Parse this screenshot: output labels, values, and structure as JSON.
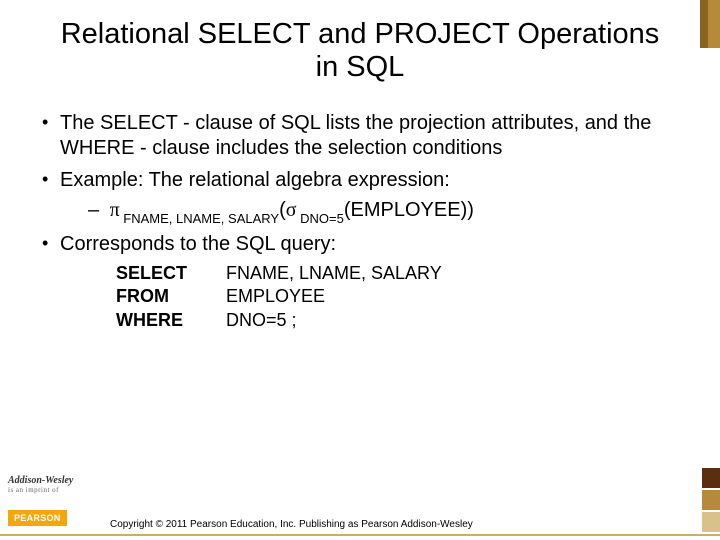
{
  "title": "Relational SELECT and PROJECT Operations in SQL",
  "bullets": {
    "b1": "The SELECT - clause of SQL lists the projection attributes, and the WHERE - clause includes the selection conditions",
    "b2": "Example: The relational algebra expression:",
    "b3": "Corresponds to the SQL query:"
  },
  "algebra": {
    "pi": "π",
    "pi_sub": " FNAME, LNAME, SALARY",
    "open": "(",
    "sigma": "σ",
    "sigma_sub": " DNO=5",
    "rest": "(EMPLOYEE))"
  },
  "sql": {
    "kw1": "SELECT",
    "v1": "FNAME, LNAME, SALARY",
    "kw2": "FROM",
    "v2": "EMPLOYEE",
    "kw3": "WHERE",
    "v3": "DNO=5 ;"
  },
  "footer": {
    "brand": "Addison-Wesley",
    "brand_sub": "is an imprint of",
    "pearson": "PEARSON",
    "copyright": "Copyright © 2011 Pearson Education, Inc. Publishing as Pearson Addison-Wesley"
  }
}
